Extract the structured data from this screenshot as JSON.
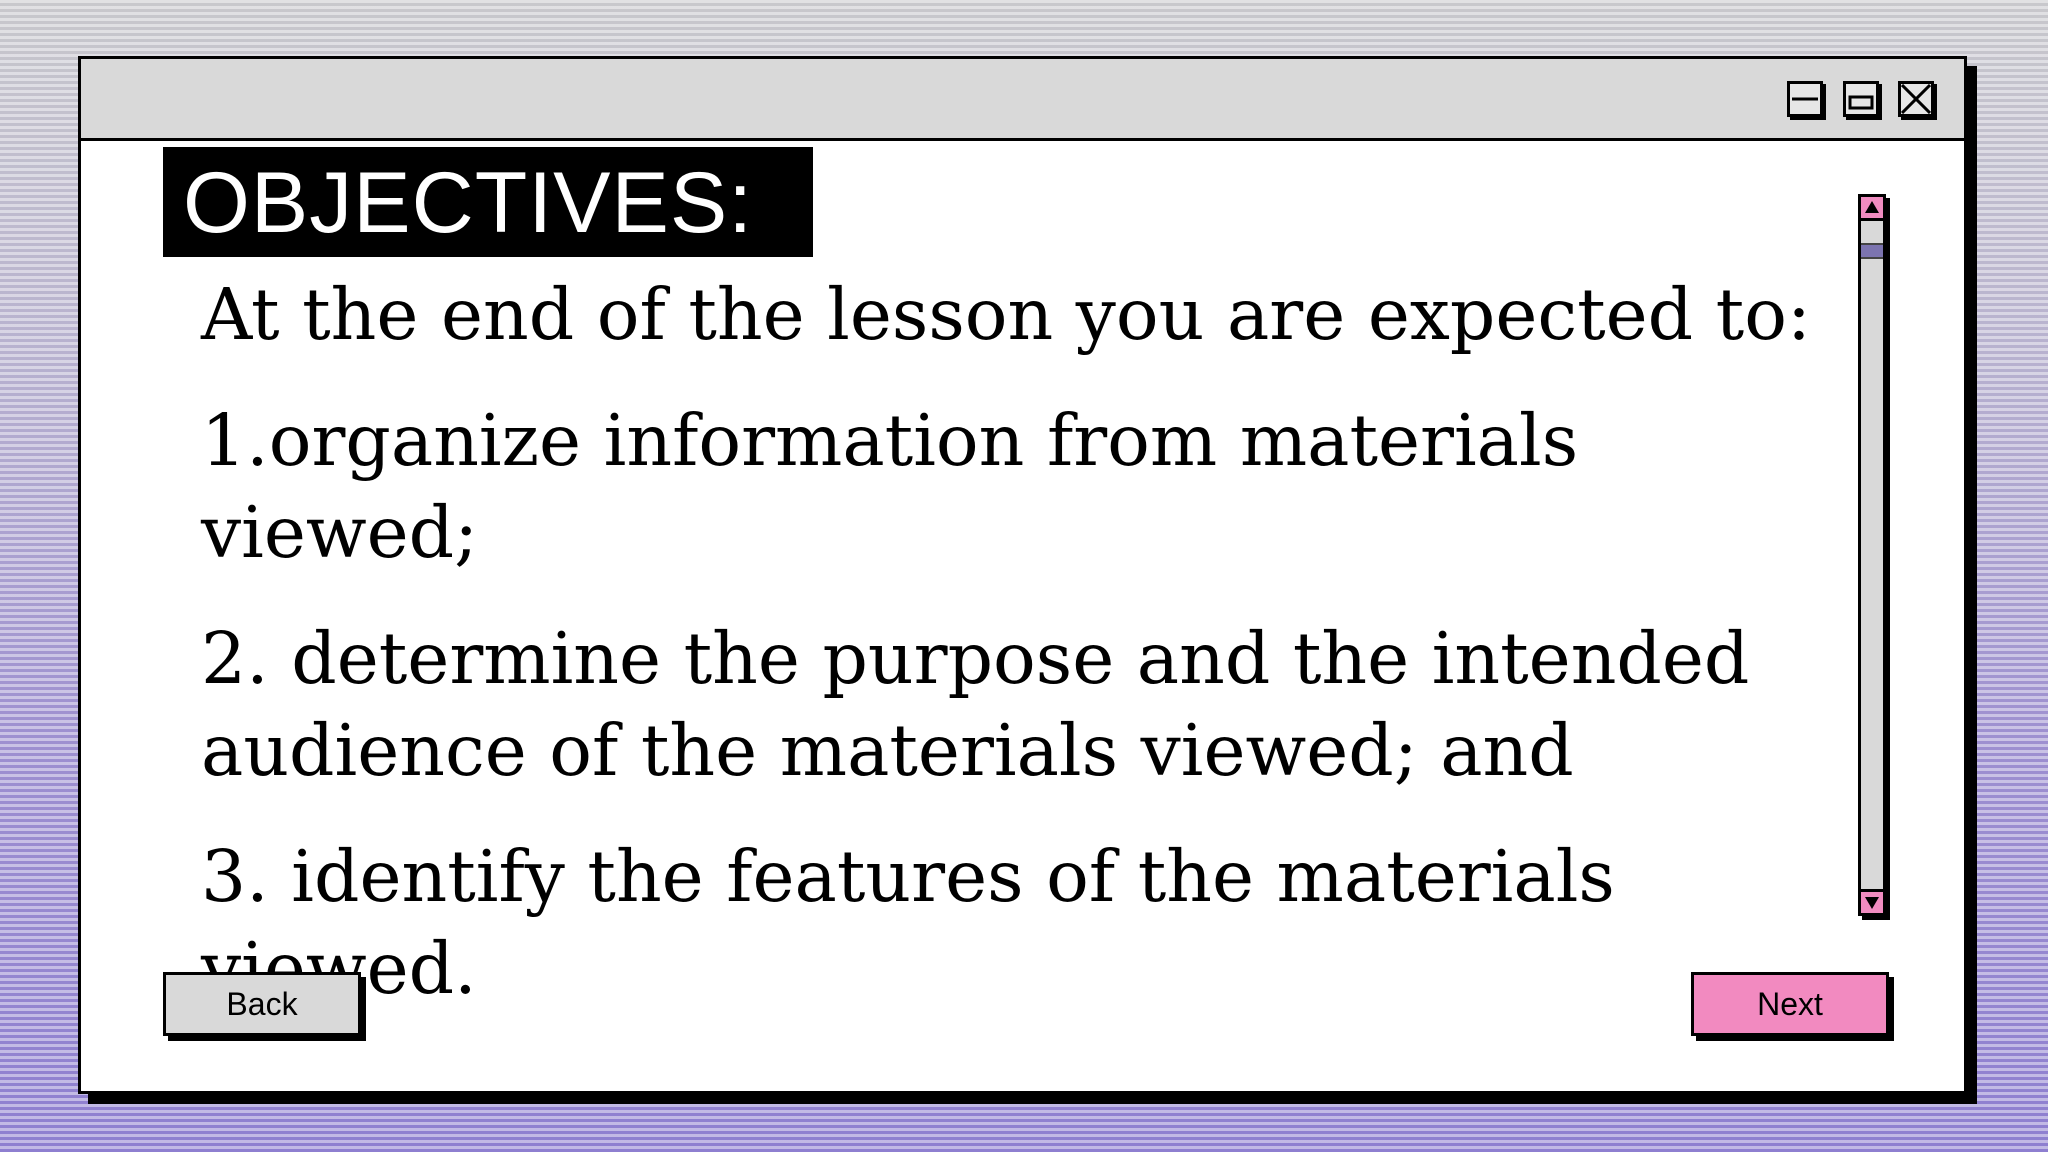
{
  "slide": {
    "heading": "OBJECTIVES:",
    "intro": "At the end of the lesson you are expected to:",
    "objectives": [
      "1.organize information from materials viewed;",
      "2. determine the purpose and the intended audience of the materials viewed; and",
      "3. identify the features of the materials viewed."
    ]
  },
  "buttons": {
    "back_label": "Back",
    "next_label": "Next"
  },
  "window_controls": {
    "minimize_icon": "minimize-icon",
    "maximize_icon": "maximize-icon",
    "close_icon": "close-icon"
  },
  "colors": {
    "accent_pink": "#f28ac0",
    "scroll_thumb": "#7c74b0",
    "titlebar": "#d9d9d9"
  }
}
